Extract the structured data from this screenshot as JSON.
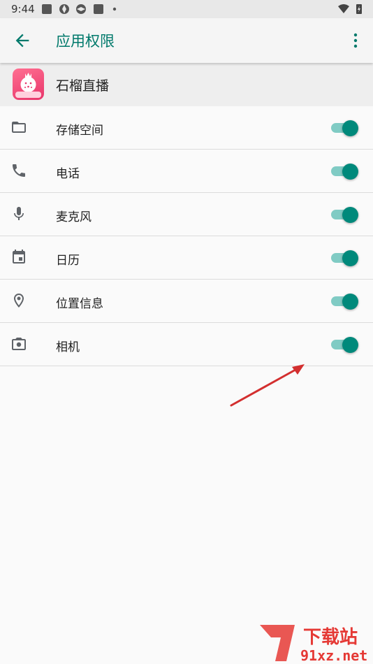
{
  "status_bar": {
    "time": "9:44",
    "icons": [
      "square-notification-icon",
      "aperture-icon",
      "aperture-icon",
      "square-notification-icon",
      "dot-icon",
      "wifi-icon",
      "battery-charging-icon"
    ]
  },
  "app_bar": {
    "title": "应用权限",
    "accent_color": "#00796b"
  },
  "app": {
    "name": "石榴直播",
    "logo_text": "视频交友"
  },
  "permissions": [
    {
      "label": "存储空间",
      "icon": "folder-icon",
      "enabled": true
    },
    {
      "label": "电话",
      "icon": "phone-icon",
      "enabled": true
    },
    {
      "label": "麦克风",
      "icon": "microphone-icon",
      "enabled": true
    },
    {
      "label": "日历",
      "icon": "calendar-icon",
      "enabled": true
    },
    {
      "label": "位置信息",
      "icon": "location-pin-icon",
      "enabled": true
    },
    {
      "label": "相机",
      "icon": "camera-icon",
      "enabled": true
    }
  ],
  "switch_colors": {
    "thumb": "#00897b",
    "track": "#80cbc4"
  },
  "watermark": {
    "title": "下载站",
    "site": "91xz.net"
  }
}
